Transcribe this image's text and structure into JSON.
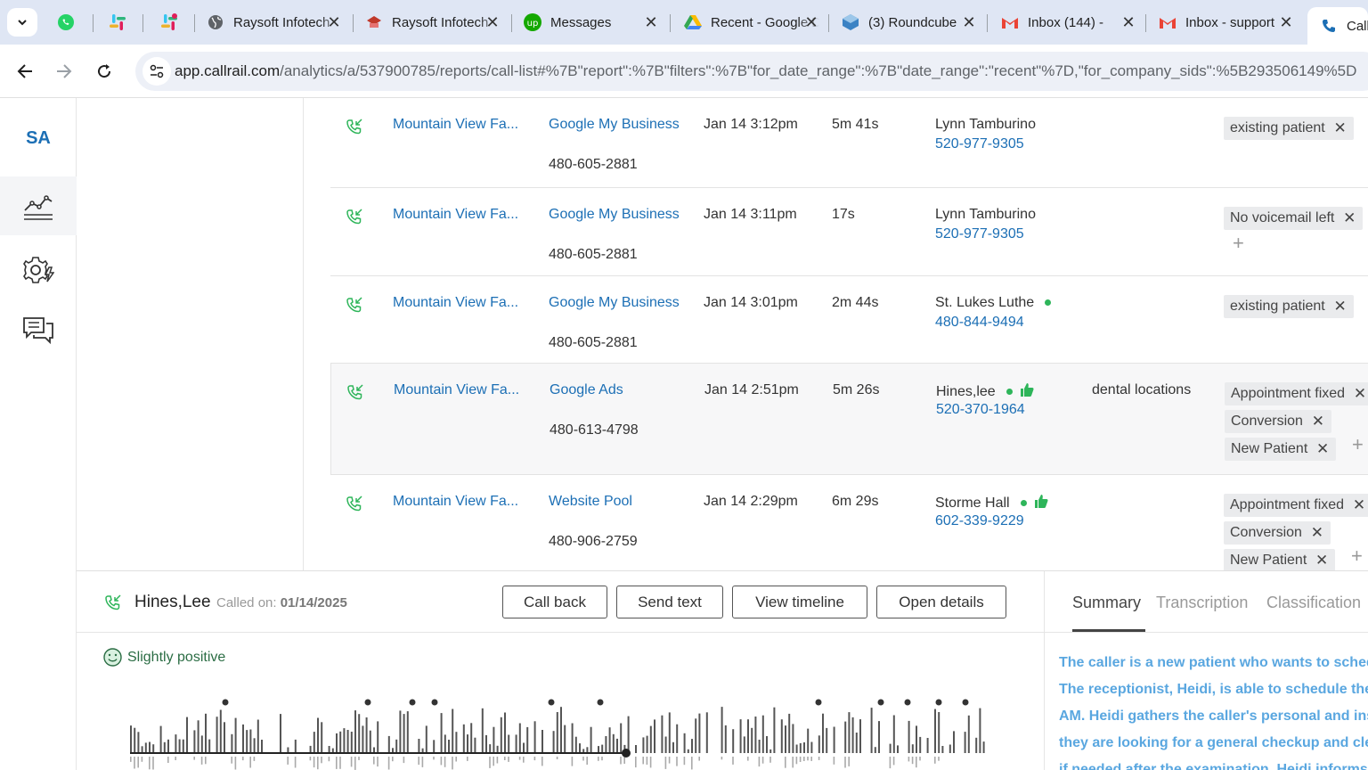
{
  "browser": {
    "tabs": [
      {
        "title": "",
        "icon": "whatsapp-icon",
        "color": "#25d366"
      },
      {
        "title": "",
        "icon": "slack-icon",
        "color": "#e01e5a"
      },
      {
        "title": "",
        "icon": "slack-icon",
        "color": "#e01e5a"
      },
      {
        "title": "Raysoft Infotech",
        "icon": "globe-icon",
        "color": "#5f6368"
      },
      {
        "title": "Raysoft Infotech",
        "icon": "raysoft-icon",
        "color": "#c0392b"
      },
      {
        "title": "Messages",
        "icon": "upwork-icon",
        "color": "#14a800"
      },
      {
        "title": "Recent - Google Drive",
        "icon": "google-drive-icon",
        "color": "#fbbc04"
      },
      {
        "title": "(3) Roundcube",
        "icon": "roundcube-icon",
        "color": "#3b82c4"
      },
      {
        "title": "Inbox (144) -",
        "icon": "gmail-icon",
        "color": "#ea4335"
      },
      {
        "title": "Inbox - support",
        "icon": "gmail-icon",
        "color": "#ea4335"
      },
      {
        "title": "Call",
        "icon": "callrail-icon",
        "color": "#1c6fb5"
      }
    ],
    "url_host": "app.callrail.com",
    "url_path": "/analytics/a/537900785/reports/call-list#%7B\"report\":%7B\"filters\":%7B\"for_date_range\":%7B\"date_range\":\"recent\"%7D,\"for_company_sids\":%5B293506149%5D"
  },
  "rail": {
    "logo": "SA",
    "items": [
      "analytics-icon",
      "settings-icon",
      "conversations-icon"
    ]
  },
  "calls": [
    {
      "company": "Mountain View Fa...",
      "source": "Google My Business",
      "tracking": "480-605-2881",
      "date": "Jan 14 3:12pm",
      "duration": "5m 41s",
      "caller": "Lynn Tamburino",
      "phone": "520-977-9305",
      "keyword": "",
      "tags": [
        "existing patient"
      ],
      "dot": false,
      "thumb": false,
      "plus": false
    },
    {
      "company": "Mountain View Fa...",
      "source": "Google My Business",
      "tracking": "480-605-2881",
      "date": "Jan 14 3:11pm",
      "duration": "17s",
      "caller": "Lynn Tamburino",
      "phone": "520-977-9305",
      "keyword": "",
      "tags": [
        "No voicemail left"
      ],
      "dot": false,
      "thumb": false,
      "plus": true
    },
    {
      "company": "Mountain View Fa...",
      "source": "Google My Business",
      "tracking": "480-605-2881",
      "date": "Jan 14 3:01pm",
      "duration": "2m 44s",
      "caller": "St. Lukes Luthe",
      "phone": "480-844-9494",
      "keyword": "",
      "tags": [
        "existing patient"
      ],
      "dot": true,
      "thumb": false,
      "plus": false
    },
    {
      "company": "Mountain View Fa...",
      "source": "Google Ads",
      "tracking": "480-613-4798",
      "date": "Jan 14 2:51pm",
      "duration": "5m 26s",
      "caller": "Hines,lee",
      "phone": "520-370-1964",
      "keyword": "dental locations",
      "tags": [
        "Appointment fixed",
        "Conversion",
        "New Patient"
      ],
      "dot": true,
      "thumb": true,
      "plus": true
    },
    {
      "company": "Mountain View Fa...",
      "source": "Website Pool",
      "tracking": "480-906-2759",
      "date": "Jan 14 2:29pm",
      "duration": "6m 29s",
      "caller": "Storme Hall",
      "phone": "602-339-9229",
      "keyword": "",
      "tags": [
        "Appointment fixed",
        "Conversion",
        "New Patient"
      ],
      "dot": true,
      "thumb": true,
      "plus": true
    }
  ],
  "detail": {
    "caller_name": "Hines,Lee",
    "called_on_label": "Called on:",
    "called_on_date": "01/14/2025",
    "buttons": {
      "call_back": "Call back",
      "send_text": "Send text",
      "view_timeline": "View timeline",
      "open_details": "Open details"
    },
    "sentiment": "Slightly positive",
    "side_tabs": {
      "summary": "Summary",
      "transcription": "Transcription",
      "classification": "Classification"
    },
    "summary_lines": [
      "The caller is a new patient who wants to schedule",
      "The receptionist, Heidi, is able to schedule the",
      "AM. Heidi gathers the caller's personal and insurance",
      "they are looking for a general checkup and cleaning",
      "if needed after the examination. Heidi informs"
    ]
  },
  "colors": {
    "accent": "#1c6fb5",
    "sentiment": "#2b6d44",
    "summary": "#5aa7e0",
    "online_dot": "#2eb55a"
  }
}
